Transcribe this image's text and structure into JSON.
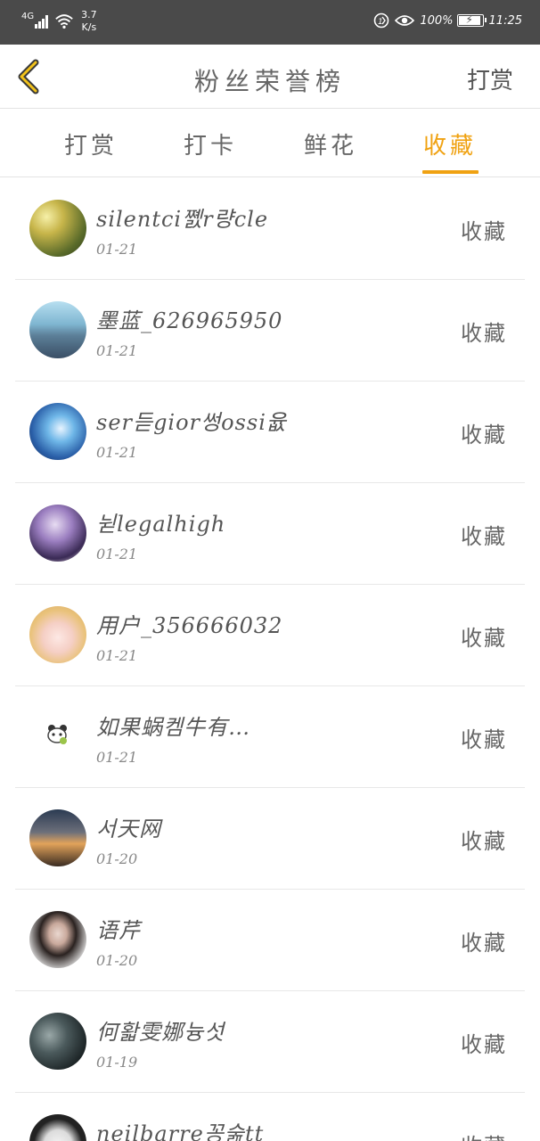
{
  "status_bar": {
    "network": "4G",
    "speed_value": "3.7",
    "speed_unit": "K/s",
    "battery": "100%",
    "battery_level": 1.0,
    "time": "11:25"
  },
  "header": {
    "title": "粉丝荣誉榜",
    "right_action": "打赏"
  },
  "tabs": [
    {
      "label": "打赏",
      "active": false
    },
    {
      "label": "打卡",
      "active": false
    },
    {
      "label": "鲜花",
      "active": false
    },
    {
      "label": "收藏",
      "active": true
    }
  ],
  "colors": {
    "accent": "#f0a212",
    "status_bar_bg": "#4a4a4a"
  },
  "fans": [
    {
      "name": "silentci쪬r량cle",
      "date": "01-21",
      "action": "收藏",
      "avatar": "sunlight-forest"
    },
    {
      "name": "墨蓝_626965950",
      "date": "01-21",
      "action": "收藏",
      "avatar": "great-wall-sky"
    },
    {
      "name": "ser듣gior썽ossi윲",
      "date": "01-21",
      "action": "收藏",
      "avatar": "anime-blue-hair"
    },
    {
      "name": "뉟legalhigh",
      "date": "01-21",
      "action": "收藏",
      "avatar": "anime-purple"
    },
    {
      "name": "用户_356666032",
      "date": "01-21",
      "action": "收藏",
      "avatar": "anime-girl-blonde"
    },
    {
      "name": "如果蜗켐牛有…",
      "date": "01-21",
      "action": "收藏",
      "avatar": "panda-sticker"
    },
    {
      "name": "서天网",
      "date": "01-20",
      "action": "收藏",
      "avatar": "sunset-landscape"
    },
    {
      "name": "语芹",
      "date": "01-20",
      "action": "收藏",
      "avatar": "woman-portrait"
    },
    {
      "name": "何홟雯娜늉섯",
      "date": "01-19",
      "action": "收藏",
      "avatar": "dark-photo"
    },
    {
      "name": "neilbarre꽁숦tt",
      "date": "",
      "action": "收藏",
      "avatar": "mask-face"
    }
  ]
}
